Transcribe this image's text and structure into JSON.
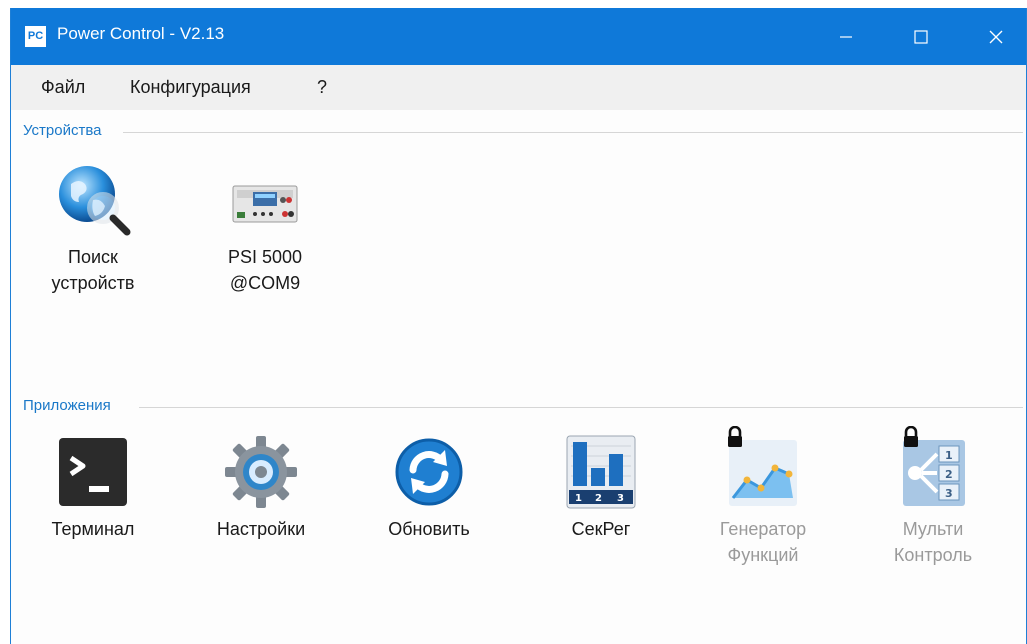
{
  "window": {
    "app_icon_text": "PC",
    "title": "Power Control - V2.13"
  },
  "menu": {
    "file": "Файл",
    "config": "Конфигурация",
    "help": "?"
  },
  "devices": {
    "group_label": "Устройства",
    "items": [
      {
        "line1": "Поиск",
        "line2": "устройств",
        "icon": "globe-search-icon"
      },
      {
        "line1": "PSI 5000",
        "line2": "@COM9",
        "icon": "power-supply-icon"
      }
    ]
  },
  "apps": {
    "group_label": "Приложения",
    "items": [
      {
        "line1": "Терминал",
        "line2": "",
        "icon": "terminal-icon",
        "enabled": true
      },
      {
        "line1": "Настройки",
        "line2": "",
        "icon": "gear-icon",
        "enabled": true
      },
      {
        "line1": "Обновить",
        "line2": "",
        "icon": "refresh-icon",
        "enabled": true
      },
      {
        "line1": "СекРег",
        "line2": "",
        "icon": "sequence-chart-icon",
        "enabled": true
      },
      {
        "line1": "Генератор",
        "line2": "Функций",
        "icon": "function-generator-icon",
        "enabled": false
      },
      {
        "line1": "Мульти",
        "line2": "Контроль",
        "icon": "multi-control-icon",
        "enabled": false
      }
    ]
  }
}
